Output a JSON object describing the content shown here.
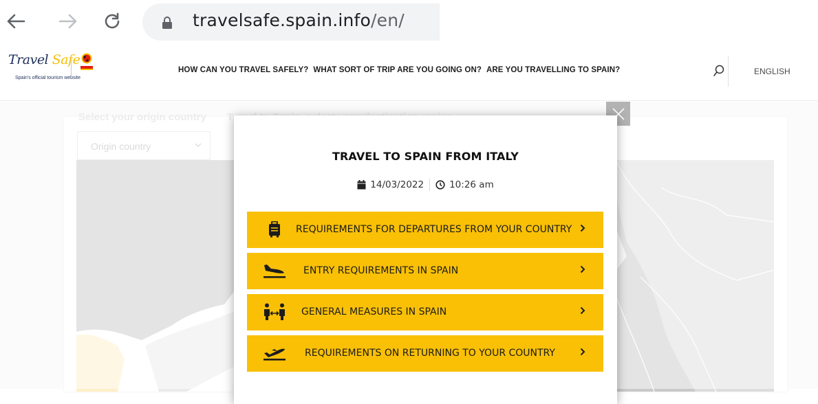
{
  "browser": {
    "url_host": "travelsafe.spain.info",
    "url_path": "/en/"
  },
  "header": {
    "logo_travel": "Travel",
    "logo_safe": "Safe",
    "logo_tagline": "Spain's official tourism website",
    "nav": [
      {
        "label": "HOW CAN YOU TRAVEL SAFELY?"
      },
      {
        "label": "WHAT SORT OF TRIP ARE YOU GOING ON?"
      },
      {
        "label": "ARE YOU TRAVELLING TO SPAIN?"
      }
    ],
    "language": "ENGLISH"
  },
  "page": {
    "origin_label": "Select your origin country",
    "destination_label": "Travel to Spain, select your destination region",
    "origin_placeholder": "Origin country"
  },
  "modal": {
    "title": "TRAVEL TO SPAIN FROM ITALY",
    "date": "14/03/2022",
    "time": "10:26 am",
    "buttons": [
      {
        "label": "REQUIREMENTS FOR DEPARTURES FROM YOUR COUNTRY",
        "icon": "luggage-icon"
      },
      {
        "label": "ENTRY REQUIREMENTS IN SPAIN",
        "icon": "plane-landing-icon"
      },
      {
        "label": "GENERAL MEASURES IN SPAIN",
        "icon": "social-distance-icon"
      },
      {
        "label": "REQUIREMENTS ON RETURNING TO YOUR COUNTRY",
        "icon": "plane-departure-icon"
      }
    ]
  },
  "colors": {
    "accent_yellow": "#f9c006",
    "brand_navy": "#1d2e5b"
  }
}
